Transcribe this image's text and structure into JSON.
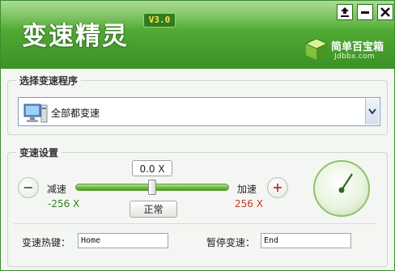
{
  "title": "变速精灵",
  "version": "V3.0",
  "brand": {
    "name": "简单百宝箱",
    "url": "Jdbbx.com"
  },
  "program_group": {
    "label": "选择变速程序",
    "selected": "全部都变速"
  },
  "speed_group": {
    "label": "变速设置",
    "current_speed": "0.0 X",
    "slow_label": "减速",
    "slow_value": "-256 X",
    "fast_label": "加速",
    "fast_value": "256 X",
    "normal_label": "正常",
    "minus_symbol": "−",
    "plus_symbol": "+",
    "speed_level": 0
  },
  "hotkeys": {
    "speed_hotkey_label": "变速热键：",
    "speed_hotkey_value": "Home",
    "pause_label": "暂停变速：",
    "pause_value": "End"
  },
  "colors": {
    "accent": "#4fa932",
    "slow": "#2e7d1e",
    "fast": "#c0392b"
  }
}
